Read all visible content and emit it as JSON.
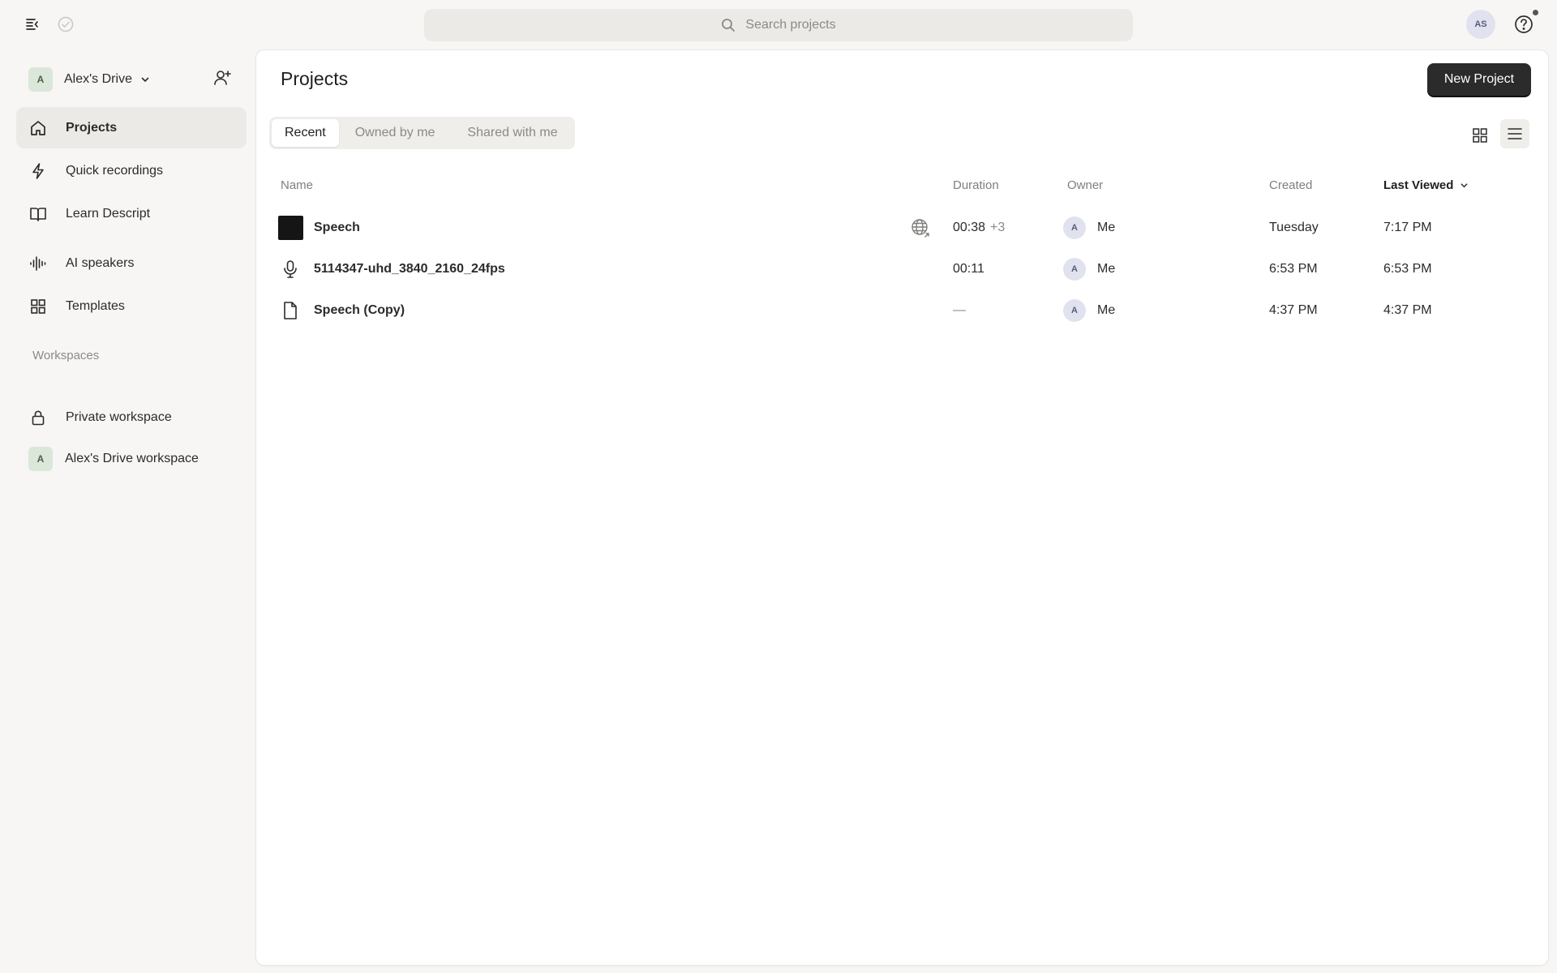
{
  "topbar": {
    "search_placeholder": "Search projects",
    "user_initials": "AS"
  },
  "sidebar": {
    "drive": {
      "avatar_letter": "A",
      "name": "Alex's Drive"
    },
    "nav": [
      {
        "label": "Projects",
        "icon": "home-icon",
        "active": true
      },
      {
        "label": "Quick recordings",
        "icon": "lightning-icon"
      },
      {
        "label": "Learn Descript",
        "icon": "book-icon"
      },
      {
        "label": "AI speakers",
        "icon": "waveform-icon"
      },
      {
        "label": "Templates",
        "icon": "grid-icon"
      }
    ],
    "workspaces_heading": "Workspaces",
    "workspaces": [
      {
        "label": "Private workspace",
        "icon": "lock-icon"
      },
      {
        "label": "Alex's Drive workspace",
        "avatar_letter": "A"
      }
    ]
  },
  "main": {
    "title": "Projects",
    "new_project_label": "New Project",
    "tabs": [
      {
        "label": "Recent",
        "active": true
      },
      {
        "label": "Owned by me"
      },
      {
        "label": "Shared with me"
      }
    ],
    "columns": {
      "name": "Name",
      "duration": "Duration",
      "owner": "Owner",
      "created": "Created",
      "last_viewed": "Last Viewed"
    },
    "rows": [
      {
        "name": "Speech",
        "icon": "video-thumbnail",
        "shared": true,
        "duration": "00:38",
        "duration_extra": "+3",
        "owner_letter": "A",
        "owner": "Me",
        "created": "Tuesday",
        "last_viewed": "7:17 PM"
      },
      {
        "name": "5114347-uhd_3840_2160_24fps",
        "icon": "microphone-icon",
        "duration": "00:11",
        "duration_extra": "",
        "owner_letter": "A",
        "owner": "Me",
        "created": "6:53 PM",
        "last_viewed": "6:53 PM"
      },
      {
        "name": "Speech (Copy)",
        "icon": "document-icon",
        "duration": "—",
        "duration_extra": "",
        "owner_letter": "A",
        "owner": "Me",
        "created": "4:37 PM",
        "last_viewed": "4:37 PM"
      }
    ]
  }
}
